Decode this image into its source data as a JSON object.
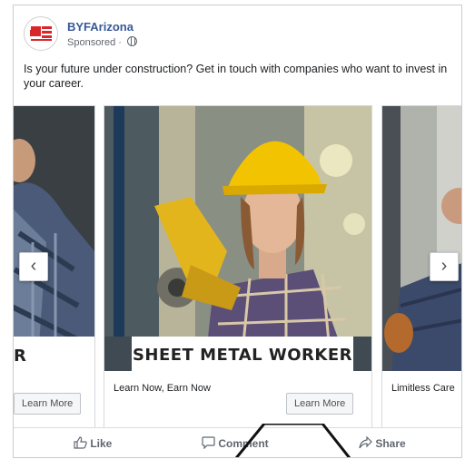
{
  "post": {
    "page_name": "BYFArizona",
    "sponsored": "Sponsored · ",
    "body": "Is your future under construction? Get in touch with companies who want to invest in your career."
  },
  "cards": [
    {
      "headline": "",
      "cta": "Learn More",
      "banner_fragment": "R"
    },
    {
      "headline": "Learn Now, Earn Now",
      "cta": "Learn More",
      "banner": "SHEET METAL WORKER"
    },
    {
      "headline": "Limitless Care",
      "cta": ""
    }
  ],
  "nav": {
    "prev": "‹",
    "next": "›"
  },
  "actions": {
    "like": "Like",
    "comment": "Comment",
    "share": "Share"
  },
  "colors": {
    "link": "#385898",
    "brand_red": "#d9262a",
    "helmet": "#f2c300",
    "glove": "#e3b51c"
  },
  "icons": [
    "globe-icon",
    "thumbs-up-icon",
    "comment-icon",
    "share-icon",
    "chevron-left-icon",
    "chevron-right-icon"
  ]
}
